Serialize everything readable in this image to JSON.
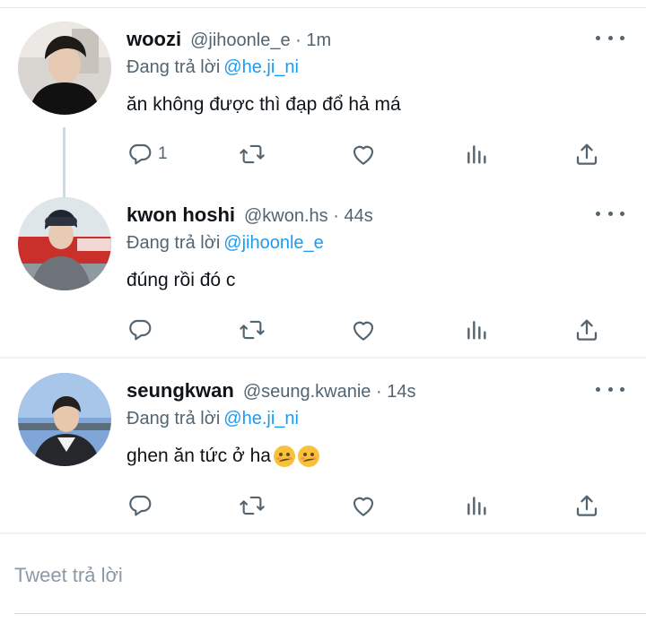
{
  "tweets": [
    {
      "name": "woozi",
      "handle_meta": "@jihoonle_e · 1m",
      "reply_prefix": "Đang trả lời",
      "reply_mention": "@he.ji_ni",
      "text": "ăn không được thì đạp đổ hả má",
      "reply_count": "1"
    },
    {
      "name": "kwon hoshi",
      "handle_meta": "@kwon.hs · 44s",
      "reply_prefix": "Đang trả lời",
      "reply_mention": "@jihoonle_e",
      "text": "đúng rồi đó c",
      "reply_count": ""
    },
    {
      "name": "seungkwan",
      "handle_meta": "@seung.kwanie · 14s",
      "reply_prefix": "Đang trả lời",
      "reply_mention": "@he.ji_ni",
      "text": "ghen ăn tức ở ha",
      "reply_count": ""
    }
  ],
  "compose": {
    "placeholder": "Tweet trả lời"
  },
  "colors": {
    "accent": "#1d9bf0",
    "secondary_text": "#536471",
    "icon": "#536471",
    "divider": "#eff3f4"
  },
  "icons": [
    "more-icon",
    "reply-icon",
    "retweet-icon",
    "like-icon",
    "stats-icon",
    "share-icon",
    "emoji-woozy-icon"
  ]
}
